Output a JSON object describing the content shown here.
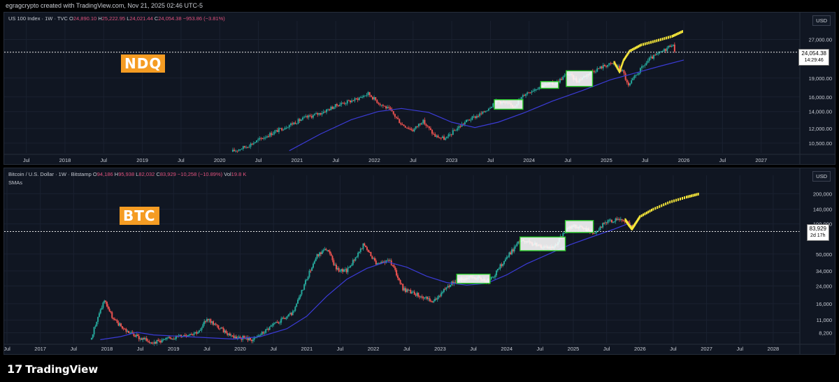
{
  "header": {
    "credit": "egragcrypto created with TradingView.com, Nov 21, 2025 02:46 UTC-5"
  },
  "footer": {
    "logo_mark": "17",
    "logo_text": "TradingView"
  },
  "colors": {
    "up": "#26a69a",
    "down": "#ef5350",
    "sma": "#3b3bd6",
    "projection": "#f5e63a",
    "box_fill": "#ffffff",
    "box_border": "#28c928",
    "tag_bg": "#f59c23"
  },
  "chart_data": [
    {
      "type": "candlestick",
      "symbol_line": "US 100 Index · 1W · TVC",
      "ohlc": {
        "o_label": "O",
        "o": "24,890.10",
        "h_label": "H",
        "h": "25,222.95",
        "l_label": "L",
        "l": "24,021.44",
        "c_label": "C",
        "c": "24,054.38",
        "change": "−953.86 (−3.81%)"
      },
      "currency": "USD",
      "tag": "NDQ",
      "last_price": "24,054.38",
      "countdown": "14:29:46",
      "scale": "log",
      "ylim": [
        9600,
        30000
      ],
      "y_ticks": [
        "27,000.00",
        "19,000.00",
        "16,000.00",
        "14,000.00",
        "12,000.00",
        "10,500.00"
      ],
      "y_tick_values": [
        27000,
        19000,
        16000,
        14000,
        12000,
        10500
      ],
      "x_ticks": [
        "Jul",
        "2018",
        "Jul",
        "2019",
        "Jul",
        "2020",
        "Jul",
        "2021",
        "Jul",
        "2022",
        "Jul",
        "2023",
        "Jul",
        "2024",
        "Jul",
        "2025",
        "Jul",
        "2026",
        "Jul",
        "2027"
      ],
      "x_tick_values": [
        2017.5,
        2018,
        2018.5,
        2019,
        2019.5,
        2020,
        2020.5,
        2021,
        2021.5,
        2022,
        2022.5,
        2023,
        2023.5,
        2024,
        2024.5,
        2025,
        2025.5,
        2026,
        2026.5,
        2027
      ],
      "xlim": [
        2017.25,
        2027.5
      ],
      "price_path": [
        [
          2020.15,
          9700
        ],
        [
          2020.35,
          10200
        ],
        [
          2020.6,
          11200
        ],
        [
          2020.9,
          12400
        ],
        [
          2021.1,
          13200
        ],
        [
          2021.3,
          13800
        ],
        [
          2021.55,
          15000
        ],
        [
          2021.75,
          15600
        ],
        [
          2021.92,
          16500
        ],
        [
          2022.05,
          15200
        ],
        [
          2022.2,
          14200
        ],
        [
          2022.35,
          12500
        ],
        [
          2022.5,
          11800
        ],
        [
          2022.62,
          12900
        ],
        [
          2022.78,
          11200
        ],
        [
          2022.92,
          10900
        ],
        [
          2023.05,
          11900
        ],
        [
          2023.2,
          12900
        ],
        [
          2023.4,
          13800
        ],
        [
          2023.58,
          15500
        ],
        [
          2023.8,
          14700
        ],
        [
          2023.95,
          16500
        ],
        [
          2024.15,
          17700
        ],
        [
          2024.35,
          18200
        ],
        [
          2024.5,
          19800
        ],
        [
          2024.62,
          18500
        ],
        [
          2024.8,
          20100
        ],
        [
          2024.98,
          21300
        ],
        [
          2025.1,
          21700
        ],
        [
          2025.22,
          20000
        ],
        [
          2025.28,
          17500
        ],
        [
          2025.38,
          19500
        ],
        [
          2025.55,
          22500
        ],
        [
          2025.75,
          24500
        ],
        [
          2025.85,
          26000
        ],
        [
          2025.89,
          24054
        ]
      ],
      "sma_path": [
        [
          2020.9,
          9800
        ],
        [
          2021.3,
          11400
        ],
        [
          2021.7,
          13000
        ],
        [
          2022.05,
          14000
        ],
        [
          2022.35,
          14400
        ],
        [
          2022.7,
          13900
        ],
        [
          2023.0,
          12700
        ],
        [
          2023.3,
          12100
        ],
        [
          2023.6,
          12700
        ],
        [
          2023.95,
          13900
        ],
        [
          2024.3,
          15400
        ],
        [
          2024.7,
          17000
        ],
        [
          2025.05,
          18700
        ],
        [
          2025.4,
          20000
        ],
        [
          2025.7,
          21200
        ],
        [
          2026.0,
          22400
        ]
      ],
      "projection_path": [
        [
          2025.1,
          21900
        ],
        [
          2025.17,
          20100
        ],
        [
          2025.22,
          22300
        ],
        [
          2025.3,
          24300
        ],
        [
          2025.45,
          25700
        ],
        [
          2025.65,
          26700
        ],
        [
          2025.85,
          27800
        ],
        [
          2026.0,
          29200
        ]
      ],
      "boxes": [
        [
          2023.55,
          2023.92,
          14300,
          15600
        ],
        [
          2024.15,
          2024.38,
          17300,
          18400
        ],
        [
          2024.48,
          2024.82,
          17600,
          20300
        ]
      ]
    },
    {
      "type": "candlestick",
      "symbol_line": "Bitcoin / U.S. Dollar · 1W · Bitstamp",
      "ohlc": {
        "o_label": "O",
        "o": "94,186",
        "h_label": "H",
        "h": "95,938",
        "l_label": "L",
        "l": "82,032",
        "c_label": "C",
        "c": "83,929",
        "change": "−10,258 (−10.89%)",
        "vol_label": "Vol",
        "vol": "19.8 K"
      },
      "indicator_label": "SMAs",
      "currency": "USD",
      "tag": "BTC",
      "last_price": "83,929",
      "countdown": "2d 17h",
      "scale": "log",
      "ylim": [
        6500,
        260000
      ],
      "y_ticks": [
        "200,000",
        "140,000",
        "100,000",
        "50,000",
        "34,000",
        "24,000",
        "16,000",
        "11,000",
        "8,200"
      ],
      "y_tick_values": [
        200000,
        140000,
        100000,
        50000,
        34000,
        24000,
        16000,
        11000,
        8200
      ],
      "x_ticks": [
        "Jul",
        "2017",
        "Jul",
        "2018",
        "Jul",
        "2019",
        "Jul",
        "2020",
        "Jul",
        "2021",
        "Jul",
        "2022",
        "Jul",
        "2023",
        "Jul",
        "2024",
        "Jul",
        "2025",
        "Jul",
        "2026",
        "Jul",
        "2027",
        "Jul",
        "2028"
      ],
      "x_tick_values": [
        2016.5,
        2017,
        2017.5,
        2018,
        2018.5,
        2019,
        2019.5,
        2020,
        2020.5,
        2021,
        2021.5,
        2022,
        2022.5,
        2023,
        2023.5,
        2024,
        2024.5,
        2025,
        2025.5,
        2026,
        2026.5,
        2027,
        2027.5,
        2028
      ],
      "xlim": [
        2016.5,
        2028.4
      ],
      "price_path": [
        [
          2017.75,
          7000
        ],
        [
          2017.96,
          17500
        ],
        [
          2018.1,
          11000
        ],
        [
          2018.3,
          8500
        ],
        [
          2018.5,
          7200
        ],
        [
          2018.7,
          6600
        ],
        [
          2019.4,
          8500
        ],
        [
          2019.5,
          11500
        ],
        [
          2019.7,
          9000
        ],
        [
          2019.9,
          7500
        ],
        [
          2020.2,
          7000
        ],
        [
          2020.45,
          9300
        ],
        [
          2020.8,
          13000
        ],
        [
          2021.0,
          29000
        ],
        [
          2021.15,
          48000
        ],
        [
          2021.3,
          57000
        ],
        [
          2021.45,
          35000
        ],
        [
          2021.6,
          34000
        ],
        [
          2021.85,
          62000
        ],
        [
          2022.05,
          40000
        ],
        [
          2022.25,
          43000
        ],
        [
          2022.45,
          22000
        ],
        [
          2022.65,
          20000
        ],
        [
          2022.9,
          16500
        ],
        [
          2023.05,
          22000
        ],
        [
          2023.25,
          28000
        ],
        [
          2023.5,
          29500
        ],
        [
          2023.75,
          27000
        ],
        [
          2023.95,
          42000
        ],
        [
          2024.2,
          68000
        ],
        [
          2024.5,
          60000
        ],
        [
          2024.7,
          58000
        ],
        [
          2024.9,
          88000
        ],
        [
          2025.0,
          97000
        ],
        [
          2025.3,
          82000
        ],
        [
          2025.5,
          105000
        ],
        [
          2025.75,
          112000
        ],
        [
          2025.86,
          95000
        ],
        [
          2025.89,
          83929
        ]
      ],
      "sma_path": [
        [
          2017.9,
          7000
        ],
        [
          2018.2,
          7500
        ],
        [
          2018.45,
          8300
        ],
        [
          2018.7,
          7800
        ],
        [
          2019.9,
          7100
        ],
        [
          2020.3,
          7500
        ],
        [
          2020.7,
          9000
        ],
        [
          2021.0,
          12000
        ],
        [
          2021.3,
          19000
        ],
        [
          2021.6,
          28000
        ],
        [
          2021.9,
          36000
        ],
        [
          2022.2,
          42000
        ],
        [
          2022.5,
          37000
        ],
        [
          2022.8,
          30000
        ],
        [
          2023.1,
          26000
        ],
        [
          2023.4,
          24500
        ],
        [
          2023.7,
          25500
        ],
        [
          2024.0,
          31000
        ],
        [
          2024.3,
          40000
        ],
        [
          2024.6,
          49000
        ],
        [
          2024.95,
          62000
        ],
        [
          2025.3,
          75000
        ],
        [
          2025.6,
          88000
        ],
        [
          2025.85,
          102000
        ]
      ],
      "projection_path": [
        [
          2025.78,
          110000
        ],
        [
          2025.83,
          98000
        ],
        [
          2025.88,
          89000
        ],
        [
          2025.93,
          100000
        ],
        [
          2026.0,
          118000
        ],
        [
          2026.2,
          140000
        ],
        [
          2026.45,
          165000
        ],
        [
          2026.7,
          185000
        ],
        [
          2026.9,
          200000
        ]
      ],
      "boxes": [
        [
          2023.25,
          2023.75,
          25500,
          31500
        ],
        [
          2024.2,
          2024.88,
          54000,
          74000
        ],
        [
          2024.88,
          2025.3,
          82000,
          108000
        ]
      ]
    }
  ]
}
